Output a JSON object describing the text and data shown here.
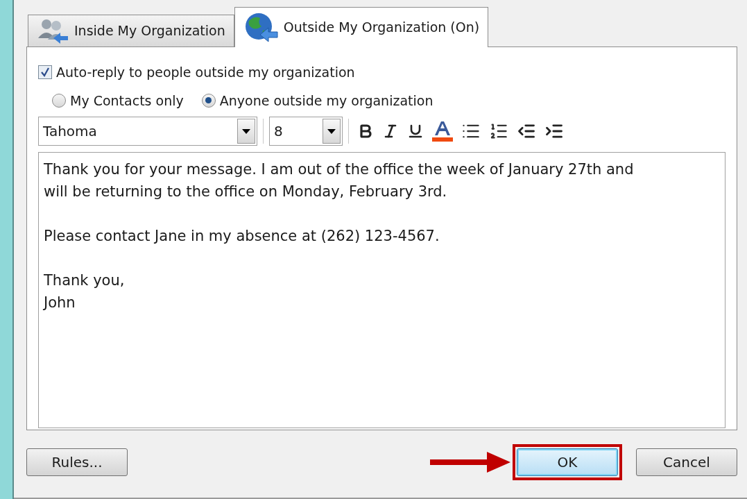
{
  "tabs": [
    {
      "label": "Inside My Organization",
      "kind": "people",
      "selected": false
    },
    {
      "label": "Outside My Organization (On)",
      "kind": "globe",
      "selected": true
    }
  ],
  "auto_reply": {
    "label": "Auto-reply to people outside my organization",
    "checked": true
  },
  "audience": [
    {
      "label": "My Contacts only",
      "selected": false
    },
    {
      "label": "Anyone outside my organization",
      "selected": true
    }
  ],
  "font": {
    "value": "Tahoma"
  },
  "size": {
    "value": "8"
  },
  "message": {
    "paragraphs": [
      [
        "Thank you for your message. I am out of the office the week of January 27th and",
        "will be returning to the office on Monday, February 3rd."
      ],
      [
        "Please contact Jane in my absence at (262) 123-4567."
      ],
      [
        "Thank you,",
        "John"
      ]
    ]
  },
  "buttons": [
    {
      "label": "Rules...",
      "highlighted": false
    },
    {
      "label": "OK",
      "highlighted": true
    },
    {
      "label": "Cancel",
      "highlighted": false
    }
  ]
}
